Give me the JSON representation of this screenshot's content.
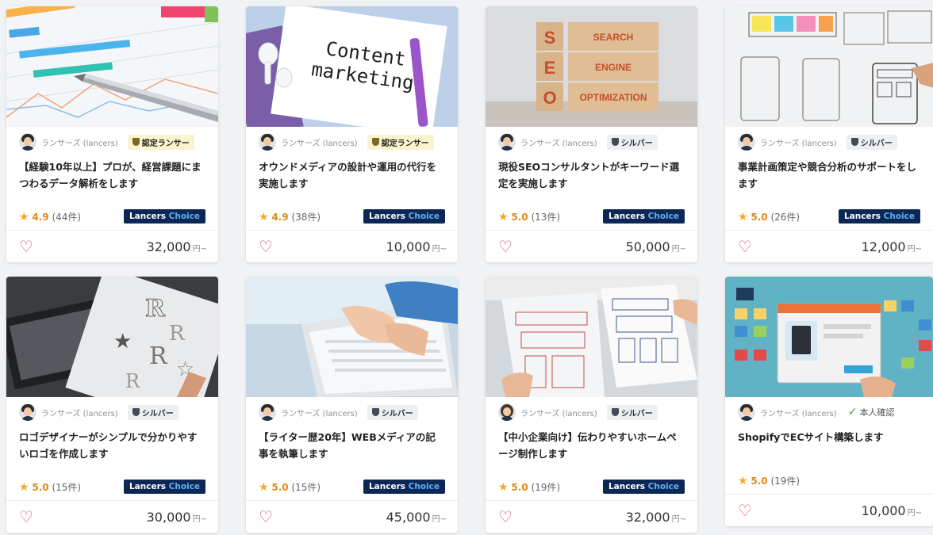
{
  "cards": [
    {
      "user": "ランサーズ (lancers)",
      "badge": "認定ランサー",
      "title": "【経験10年以上】プロが、経営課題にまつわるデータ解析をします",
      "score": "4.9",
      "count": "(44件)",
      "choice1": "Lancers",
      "choice2": "Choice",
      "price": "32,000",
      "unit": "円~"
    },
    {
      "user": "ランサーズ (lancers)",
      "badge": "認定ランサー",
      "title": "オウンドメディアの設計や運用の代行を実施します",
      "score": "4.9",
      "count": "(38件)",
      "choice1": "Lancers",
      "choice2": "Choice",
      "price": "10,000",
      "unit": "円~",
      "thumb_text": [
        "Content",
        "marketing"
      ]
    },
    {
      "user": "ランサーズ (lancers)",
      "badge": "シルバー",
      "title": "現役SEOコンサルタントがキーワード選定を実施します",
      "score": "5.0",
      "count": "(13件)",
      "choice1": "Lancers",
      "choice2": "Choice",
      "price": "50,000",
      "unit": "円~",
      "thumb_text": [
        "S",
        "E",
        "O",
        "SEARCH",
        "ENGINE",
        "OPTIMIZATION"
      ]
    },
    {
      "user": "ランサーズ (lancers)",
      "badge": "シルバー",
      "title": "事業計画策定や競合分析のサポートをします",
      "score": "5.0",
      "count": "(26件)",
      "choice1": "Lancers",
      "choice2": "Choice",
      "price": "12,000",
      "unit": "円~"
    },
    {
      "user": "ランサーズ (lancers)",
      "badge": "シルバー",
      "title": "ロゴデザイナーがシンプルで分かりやすいロゴを作成します",
      "score": "5.0",
      "count": "(15件)",
      "choice1": "Lancers",
      "choice2": "Choice",
      "price": "30,000",
      "unit": "円~"
    },
    {
      "user": "ランサーズ (lancers)",
      "badge": "シルバー",
      "title": "【ライター歴20年】WEBメディアの記事を執筆します",
      "score": "5.0",
      "count": "(15件)",
      "choice1": "Lancers",
      "choice2": "Choice",
      "price": "45,000",
      "unit": "円~"
    },
    {
      "user": "ランサーズ (lancers)",
      "badge": "シルバー",
      "title": "【中小企業向け】伝わりやすいホームページ制作します",
      "score": "5.0",
      "count": "(19件)",
      "choice1": "Lancers",
      "choice2": "Choice",
      "price": "32,000",
      "unit": "円~"
    },
    {
      "user": "ランサーズ (lancers)",
      "badge": "本人確認",
      "title": "ShopifyでECサイト構築します",
      "score": "5.0",
      "count": "(19件)",
      "price": "10,000",
      "unit": "円~"
    }
  ],
  "colors": {
    "choice_bg": "#0c2755",
    "heart": "#e3485a",
    "star": "#f5a623"
  }
}
